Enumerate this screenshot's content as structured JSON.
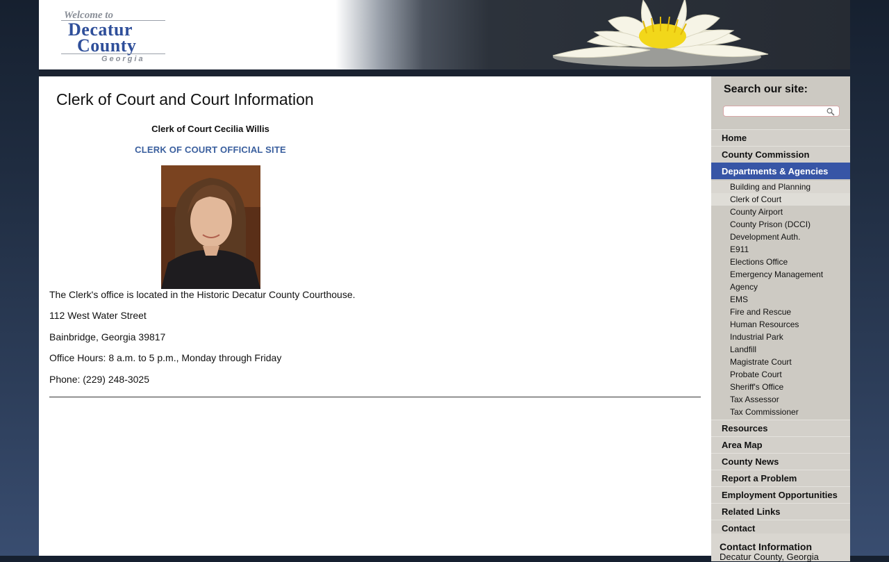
{
  "logo": {
    "welcome": "Welcome to",
    "line1": "Decatur",
    "line2": "County",
    "sub": "Georgia"
  },
  "page": {
    "title": "Clerk of Court and Court Information",
    "clerk_name": "Clerk of Court Cecilia Willis",
    "official_link": "CLERK OF COURT OFFICIAL SITE",
    "info": [
      "The Clerk's office is located in the Historic Decatur County Courthouse.",
      "112 West Water Street",
      "Bainbridge, Georgia 39817",
      "Office Hours: 8 a.m. to 5 p.m., Monday through Friday",
      "Phone: (229) 248-3025"
    ]
  },
  "search": {
    "label": "Search our site:",
    "placeholder": ""
  },
  "nav": {
    "top": [
      "Home",
      "County Commission"
    ],
    "active": "Departments & Agencies",
    "sub": [
      "Building and Planning",
      "Clerk of Court",
      "County Airport",
      "County Prison (DCCI)",
      "Development Auth.",
      "E911",
      "Elections Office",
      "Emergency Management",
      "Agency",
      "EMS",
      "Fire and Rescue",
      "Human Resources",
      "Industrial Park",
      "Landfill",
      "Magistrate Court",
      "Probate Court",
      "Sheriff's Office",
      "Tax Assessor",
      "Tax Commissioner"
    ],
    "bottom": [
      "Resources",
      "Area Map",
      "County News",
      "Report a Problem",
      "Employment Opportunities",
      "Related Links",
      "Contact"
    ]
  },
  "contact": {
    "title": "Contact Information",
    "line": "Decatur County, Georgia"
  },
  "colors": {
    "accent": "#3755a6",
    "link": "#3a5f9e",
    "sidebar": "#ccc9c2"
  }
}
